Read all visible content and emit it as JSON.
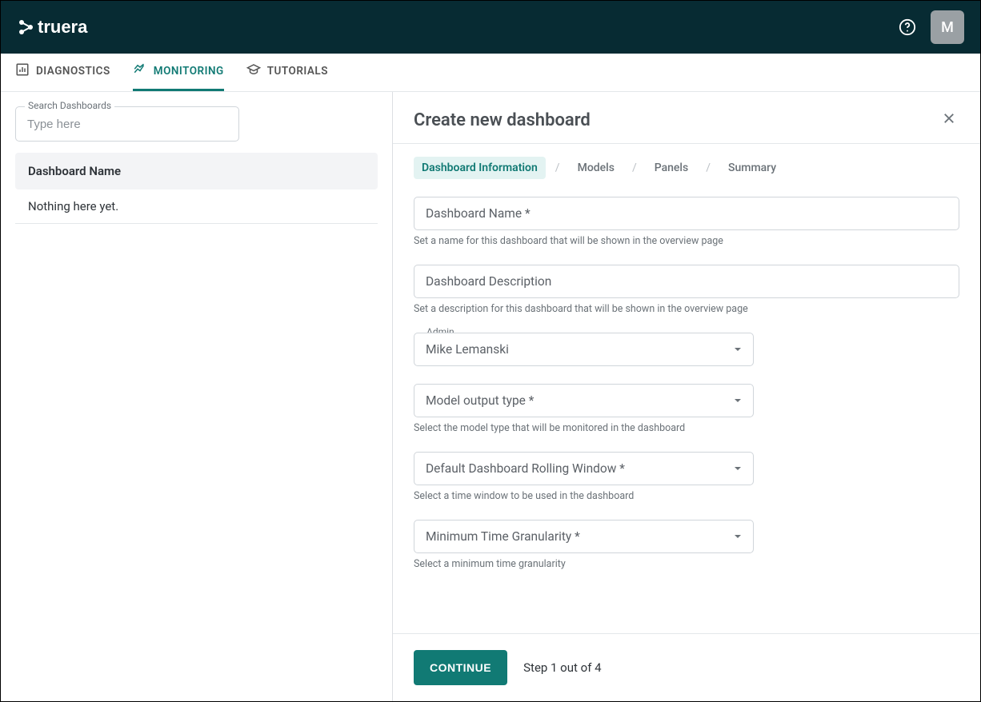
{
  "header": {
    "logo_text": "truera",
    "avatar_initial": "M"
  },
  "tabs": {
    "diagnostics": "DIAGNOSTICS",
    "monitoring": "MONITORING",
    "tutorials": "TUTORIALS"
  },
  "sidebar": {
    "search_label": "Search Dashboards",
    "search_placeholder": "Type here",
    "list_header": "Dashboard Name",
    "empty_row": "Nothing here yet."
  },
  "panel": {
    "title": "Create new dashboard",
    "crumbs": {
      "info": "Dashboard Information",
      "models": "Models",
      "panels": "Panels",
      "summary": "Summary",
      "sep": "/"
    },
    "fields": {
      "name_placeholder": "Dashboard Name *",
      "name_helper": "Set a name for this dashboard that will be shown in the overview page",
      "desc_placeholder": "Dashboard Description",
      "desc_helper": "Set a description for this dashboard that will be shown in the overview page",
      "admin_label": "Admin",
      "admin_value": "Mike Lemanski",
      "model_output_placeholder": "Model output type *",
      "model_output_helper": "Select the model type that will be monitored in the dashboard",
      "rolling_window_placeholder": "Default Dashboard Rolling Window *",
      "rolling_window_helper": "Select a time window to be used in the dashboard",
      "min_granularity_placeholder": "Minimum Time Granularity *",
      "min_granularity_helper": "Select a minimum time granularity"
    },
    "footer": {
      "continue": "CONTINUE",
      "step_text": "Step 1 out of 4"
    }
  }
}
